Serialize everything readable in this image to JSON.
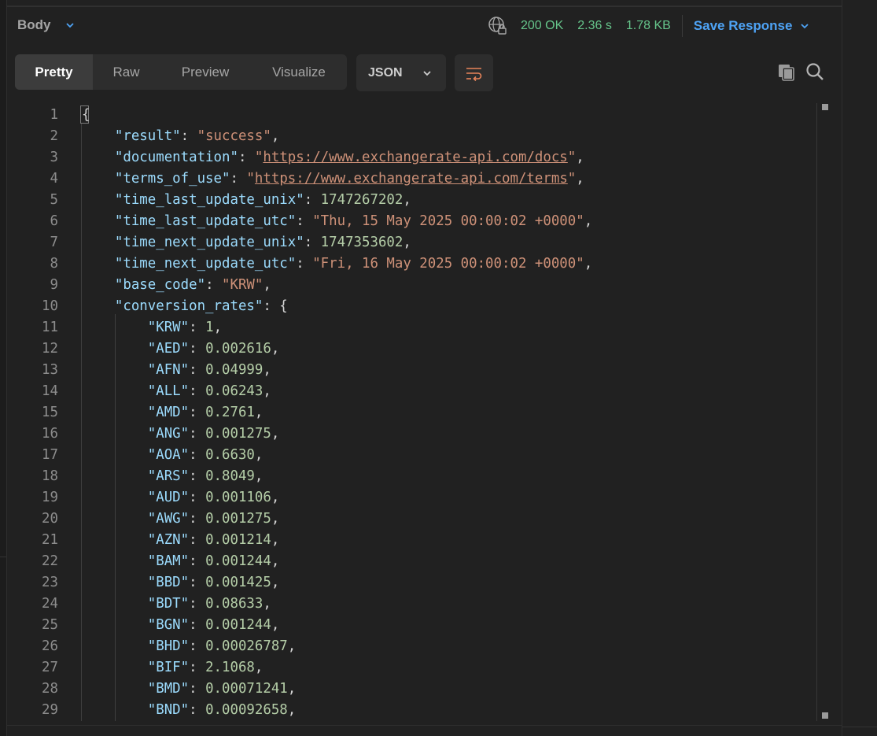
{
  "header": {
    "body_label": "Body",
    "status_code": "200 OK",
    "time": "2.36 s",
    "size": "1.78 KB",
    "save_response_label": "Save Response"
  },
  "view_tabs": [
    "Pretty",
    "Raw",
    "Preview",
    "Visualize"
  ],
  "active_view": "Pretty",
  "format": "JSON",
  "icons": {
    "globe": "globe-lock-icon",
    "wrap": "wrap-lines-icon",
    "copy": "copy-icon",
    "search": "search-icon"
  },
  "colors": {
    "key": "#9cdcfe",
    "string": "#ce9178",
    "number": "#b5cea8",
    "status": "#66c58b",
    "accent": "#4ea3f5"
  },
  "lines": [
    {
      "n": "1",
      "parts": [
        [
          "p",
          "{"
        ]
      ]
    },
    {
      "n": "2",
      "parts": [
        [
          "p",
          "    "
        ],
        [
          "k",
          "\"result\""
        ],
        [
          "p",
          ": "
        ],
        [
          "s",
          "\"success\""
        ],
        [
          "p",
          ","
        ]
      ]
    },
    {
      "n": "3",
      "parts": [
        [
          "p",
          "    "
        ],
        [
          "k",
          "\"documentation\""
        ],
        [
          "p",
          ": "
        ],
        [
          "s",
          "\""
        ],
        [
          "su",
          "https://www.exchangerate-api.com/docs"
        ],
        [
          "s",
          "\""
        ],
        [
          "p",
          ","
        ]
      ]
    },
    {
      "n": "4",
      "parts": [
        [
          "p",
          "    "
        ],
        [
          "k",
          "\"terms_of_use\""
        ],
        [
          "p",
          ": "
        ],
        [
          "s",
          "\""
        ],
        [
          "su",
          "https://www.exchangerate-api.com/terms"
        ],
        [
          "s",
          "\""
        ],
        [
          "p",
          ","
        ]
      ]
    },
    {
      "n": "5",
      "parts": [
        [
          "p",
          "    "
        ],
        [
          "k",
          "\"time_last_update_unix\""
        ],
        [
          "p",
          ": "
        ],
        [
          "n",
          "1747267202"
        ],
        [
          "p",
          ","
        ]
      ]
    },
    {
      "n": "6",
      "parts": [
        [
          "p",
          "    "
        ],
        [
          "k",
          "\"time_last_update_utc\""
        ],
        [
          "p",
          ": "
        ],
        [
          "s",
          "\"Thu, 15 May 2025 00:00:02 +0000\""
        ],
        [
          "p",
          ","
        ]
      ]
    },
    {
      "n": "7",
      "parts": [
        [
          "p",
          "    "
        ],
        [
          "k",
          "\"time_next_update_unix\""
        ],
        [
          "p",
          ": "
        ],
        [
          "n",
          "1747353602"
        ],
        [
          "p",
          ","
        ]
      ]
    },
    {
      "n": "8",
      "parts": [
        [
          "p",
          "    "
        ],
        [
          "k",
          "\"time_next_update_utc\""
        ],
        [
          "p",
          ": "
        ],
        [
          "s",
          "\"Fri, 16 May 2025 00:00:02 +0000\""
        ],
        [
          "p",
          ","
        ]
      ]
    },
    {
      "n": "9",
      "parts": [
        [
          "p",
          "    "
        ],
        [
          "k",
          "\"base_code\""
        ],
        [
          "p",
          ": "
        ],
        [
          "s",
          "\"KRW\""
        ],
        [
          "p",
          ","
        ]
      ]
    },
    {
      "n": "10",
      "parts": [
        [
          "p",
          "    "
        ],
        [
          "k",
          "\"conversion_rates\""
        ],
        [
          "p",
          ": {"
        ]
      ]
    },
    {
      "n": "11",
      "parts": [
        [
          "p",
          "        "
        ],
        [
          "k",
          "\"KRW\""
        ],
        [
          "p",
          ": "
        ],
        [
          "n",
          "1"
        ],
        [
          "p",
          ","
        ]
      ]
    },
    {
      "n": "12",
      "parts": [
        [
          "p",
          "        "
        ],
        [
          "k",
          "\"AED\""
        ],
        [
          "p",
          ": "
        ],
        [
          "n",
          "0.002616"
        ],
        [
          "p",
          ","
        ]
      ]
    },
    {
      "n": "13",
      "parts": [
        [
          "p",
          "        "
        ],
        [
          "k",
          "\"AFN\""
        ],
        [
          "p",
          ": "
        ],
        [
          "n",
          "0.04999"
        ],
        [
          "p",
          ","
        ]
      ]
    },
    {
      "n": "14",
      "parts": [
        [
          "p",
          "        "
        ],
        [
          "k",
          "\"ALL\""
        ],
        [
          "p",
          ": "
        ],
        [
          "n",
          "0.06243"
        ],
        [
          "p",
          ","
        ]
      ]
    },
    {
      "n": "15",
      "parts": [
        [
          "p",
          "        "
        ],
        [
          "k",
          "\"AMD\""
        ],
        [
          "p",
          ": "
        ],
        [
          "n",
          "0.2761"
        ],
        [
          "p",
          ","
        ]
      ]
    },
    {
      "n": "16",
      "parts": [
        [
          "p",
          "        "
        ],
        [
          "k",
          "\"ANG\""
        ],
        [
          "p",
          ": "
        ],
        [
          "n",
          "0.001275"
        ],
        [
          "p",
          ","
        ]
      ]
    },
    {
      "n": "17",
      "parts": [
        [
          "p",
          "        "
        ],
        [
          "k",
          "\"AOA\""
        ],
        [
          "p",
          ": "
        ],
        [
          "n",
          "0.6630"
        ],
        [
          "p",
          ","
        ]
      ]
    },
    {
      "n": "18",
      "parts": [
        [
          "p",
          "        "
        ],
        [
          "k",
          "\"ARS\""
        ],
        [
          "p",
          ": "
        ],
        [
          "n",
          "0.8049"
        ],
        [
          "p",
          ","
        ]
      ]
    },
    {
      "n": "19",
      "parts": [
        [
          "p",
          "        "
        ],
        [
          "k",
          "\"AUD\""
        ],
        [
          "p",
          ": "
        ],
        [
          "n",
          "0.001106"
        ],
        [
          "p",
          ","
        ]
      ]
    },
    {
      "n": "20",
      "parts": [
        [
          "p",
          "        "
        ],
        [
          "k",
          "\"AWG\""
        ],
        [
          "p",
          ": "
        ],
        [
          "n",
          "0.001275"
        ],
        [
          "p",
          ","
        ]
      ]
    },
    {
      "n": "21",
      "parts": [
        [
          "p",
          "        "
        ],
        [
          "k",
          "\"AZN\""
        ],
        [
          "p",
          ": "
        ],
        [
          "n",
          "0.001214"
        ],
        [
          "p",
          ","
        ]
      ]
    },
    {
      "n": "22",
      "parts": [
        [
          "p",
          "        "
        ],
        [
          "k",
          "\"BAM\""
        ],
        [
          "p",
          ": "
        ],
        [
          "n",
          "0.001244"
        ],
        [
          "p",
          ","
        ]
      ]
    },
    {
      "n": "23",
      "parts": [
        [
          "p",
          "        "
        ],
        [
          "k",
          "\"BBD\""
        ],
        [
          "p",
          ": "
        ],
        [
          "n",
          "0.001425"
        ],
        [
          "p",
          ","
        ]
      ]
    },
    {
      "n": "24",
      "parts": [
        [
          "p",
          "        "
        ],
        [
          "k",
          "\"BDT\""
        ],
        [
          "p",
          ": "
        ],
        [
          "n",
          "0.08633"
        ],
        [
          "p",
          ","
        ]
      ]
    },
    {
      "n": "25",
      "parts": [
        [
          "p",
          "        "
        ],
        [
          "k",
          "\"BGN\""
        ],
        [
          "p",
          ": "
        ],
        [
          "n",
          "0.001244"
        ],
        [
          "p",
          ","
        ]
      ]
    },
    {
      "n": "26",
      "parts": [
        [
          "p",
          "        "
        ],
        [
          "k",
          "\"BHD\""
        ],
        [
          "p",
          ": "
        ],
        [
          "n",
          "0.00026787"
        ],
        [
          "p",
          ","
        ]
      ]
    },
    {
      "n": "27",
      "parts": [
        [
          "p",
          "        "
        ],
        [
          "k",
          "\"BIF\""
        ],
        [
          "p",
          ": "
        ],
        [
          "n",
          "2.1068"
        ],
        [
          "p",
          ","
        ]
      ]
    },
    {
      "n": "28",
      "parts": [
        [
          "p",
          "        "
        ],
        [
          "k",
          "\"BMD\""
        ],
        [
          "p",
          ": "
        ],
        [
          "n",
          "0.00071241"
        ],
        [
          "p",
          ","
        ]
      ]
    },
    {
      "n": "29",
      "parts": [
        [
          "p",
          "        "
        ],
        [
          "k",
          "\"BND\""
        ],
        [
          "p",
          ": "
        ],
        [
          "n",
          "0.00092658"
        ],
        [
          "p",
          ","
        ]
      ]
    }
  ]
}
